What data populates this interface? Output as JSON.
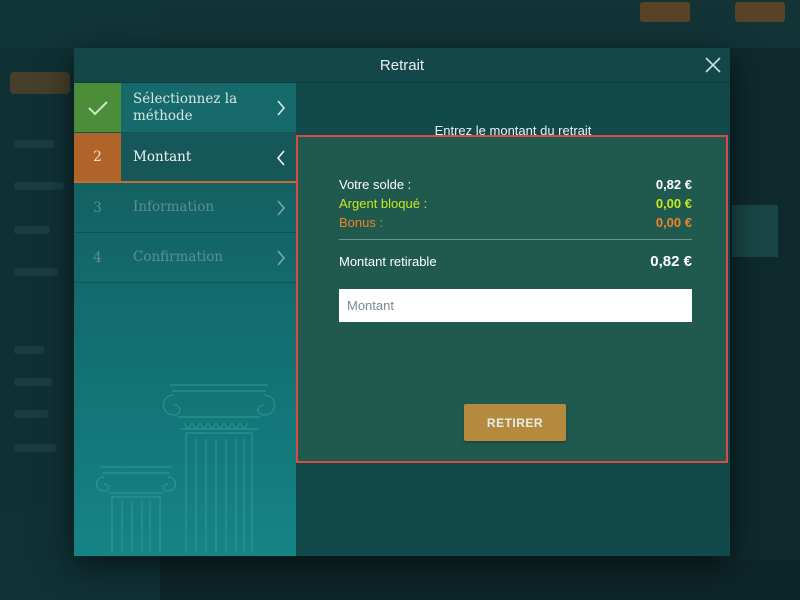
{
  "modal": {
    "title": "Retrait"
  },
  "steps": [
    {
      "number": "",
      "label": "Sélectionnez la méthode",
      "state": "done"
    },
    {
      "number": "2",
      "label": "Montant",
      "state": "active"
    },
    {
      "number": "3",
      "label": "Information",
      "state": "pending"
    },
    {
      "number": "4",
      "label": "Confirmation",
      "state": "pending"
    }
  ],
  "content": {
    "heading": "Entrez le montant du retrait",
    "balance": {
      "solde_label": "Votre solde :",
      "solde_value": "0,82 €",
      "bloque_label": "Argent bloqué :",
      "bloque_value": "0,00 €",
      "bonus_label": "Bonus :",
      "bonus_value": "0,00 €",
      "retirable_label": "Montant retirable",
      "retirable_value": "0,82 €"
    },
    "amount_placeholder": "Montant",
    "submit_label": "RETIRER"
  },
  "colors": {
    "accent_orange": "#b0642a",
    "done_green": "#4c8d3a",
    "panel_border": "#d64b48",
    "blocked_yellow": "#c7e81e",
    "bonus_orange": "#e8862a"
  }
}
